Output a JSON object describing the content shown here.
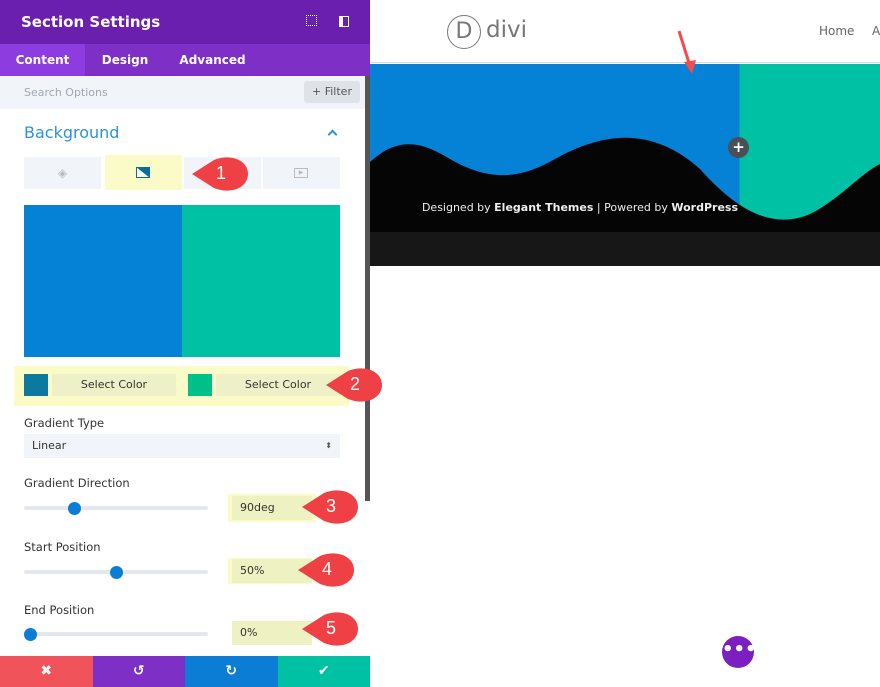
{
  "panel": {
    "title": "Section Settings",
    "tabs": [
      "Content",
      "Design",
      "Advanced"
    ],
    "active_tab": "Content",
    "search_placeholder": "Search Options",
    "filter_label": "+ Filter",
    "section_title": "Background",
    "bg_types": [
      "color-fill-icon",
      "gradient-icon",
      "image-icon",
      "video-icon"
    ],
    "active_bg_type": "gradient",
    "preview_colors": [
      "#0582d6",
      "#00c1a3"
    ],
    "color1": {
      "swatch": "#0b7a9e",
      "label": "Select Color"
    },
    "color2": {
      "swatch": "#00c08a",
      "label": "Select Color"
    },
    "gradient_type_label": "Gradient Type",
    "gradient_type_value": "Linear",
    "direction_label": "Gradient Direction",
    "direction_value": "90deg",
    "direction_slider": 0.26,
    "start_label": "Start Position",
    "start_value": "50%",
    "start_slider": 0.5,
    "end_label": "End Position",
    "end_value": "0%",
    "end_slider": 0,
    "footer_buttons": [
      {
        "icon": "close-icon",
        "glyph": "✖",
        "color": "#f0545a"
      },
      {
        "icon": "undo-icon",
        "glyph": "↺",
        "color": "#7e2fc6"
      },
      {
        "icon": "redo-icon",
        "glyph": "↻",
        "color": "#0c7dd4"
      },
      {
        "icon": "check-icon",
        "glyph": "✔",
        "color": "#00c1a3"
      }
    ]
  },
  "annotations": [
    "1",
    "2",
    "3",
    "4",
    "5"
  ],
  "site": {
    "logo_letter": "D",
    "logo_text": "divi",
    "nav": [
      "Home",
      "A"
    ],
    "footer_parts": [
      "Designed by ",
      "Elegant Themes",
      " | Powered by ",
      "WordPress"
    ],
    "colors": {
      "left": "#0582d6",
      "right": "#00c1a3"
    }
  }
}
